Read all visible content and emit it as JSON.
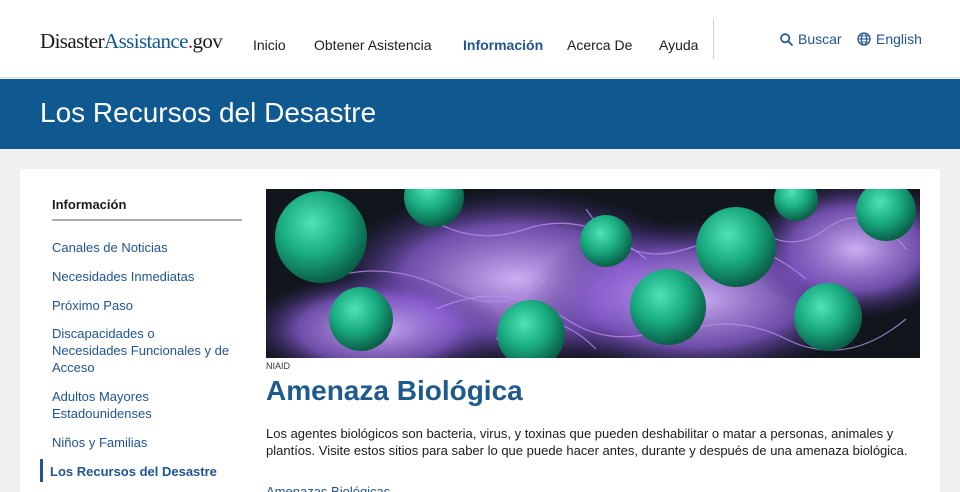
{
  "header": {
    "logo": {
      "part1": "Disaster",
      "part2": "Assistance",
      "dot": ".",
      "part3": "gov"
    },
    "nav": [
      {
        "label": "Inicio"
      },
      {
        "label": "Obtener Asistencia"
      },
      {
        "label": "Información",
        "active": true
      },
      {
        "label": "Acerca De"
      },
      {
        "label": "Ayuda"
      }
    ],
    "search_label": "Buscar",
    "search_icon": "search-icon",
    "language_label": "English",
    "language_icon": "globe-icon"
  },
  "banner": {
    "title": "Los Recursos del Desastre"
  },
  "sidebar": {
    "title": "Información",
    "items": [
      {
        "label": "Canales de Noticias"
      },
      {
        "label": "Necesidades Inmediatas"
      },
      {
        "label": "Próximo Paso"
      },
      {
        "label": "Discapacidades o Necesidades Funcionales y de Acceso"
      },
      {
        "label": "Adultos Mayores Estadounidenses"
      },
      {
        "label": "Niños y Familias"
      },
      {
        "label": "Los Recursos del Desastre",
        "current": true
      }
    ]
  },
  "main": {
    "image_caption": "NIAID",
    "title": "Amenaza Biológica",
    "body": "Los agentes biológicos son bacteria, virus, y toxinas que pueden deshabilitar o matar a personas, animales y plantíos. Visite estos sitios para saber lo que puede hacer antes, durante y después de una amenaza biológica.",
    "link": "Amenazas Biológicas"
  },
  "colors": {
    "brand_blue": "#0f5890",
    "link_blue": "#205493",
    "logo_dot": "#c8102e"
  }
}
